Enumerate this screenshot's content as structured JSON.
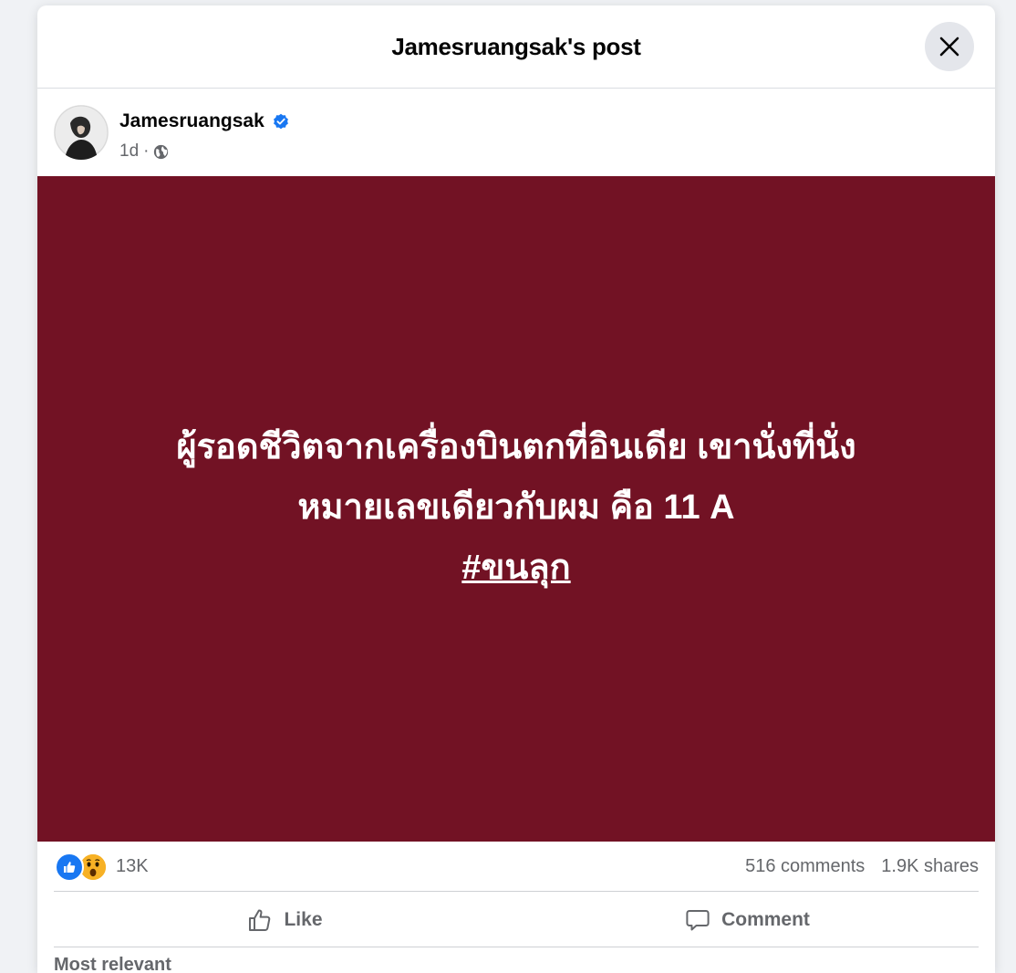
{
  "modal": {
    "title": "Jamesruangsak's post"
  },
  "post": {
    "author": "Jamesruangsak",
    "time": "1d",
    "separator": "·",
    "text_lines": [
      "ผู้รอดชีวิตจากเครื่องบินตกที่อินเดีย เขานั่งที่นั่ง",
      "หมายเลขเดียวกับผม คือ 11 A"
    ],
    "hashtag": "#ขนลุก",
    "background_color": "#721224"
  },
  "stats": {
    "reactions_count": "13K",
    "comments": "516 comments",
    "shares": "1.9K shares"
  },
  "actions": {
    "like_label": "Like",
    "comment_label": "Comment"
  },
  "comments_section": {
    "sort_label": "Most relevant"
  },
  "icons": {
    "close": "close-icon",
    "verified": "verified-badge-icon",
    "privacy": "globe-icon",
    "like_reaction": "like-reaction-icon",
    "wow_reaction": "wow-reaction-icon",
    "like": "thumbs-up-icon",
    "comment": "comment-bubble-icon"
  },
  "colors": {
    "accent": "#1877f2",
    "secondary_text": "#65676b"
  }
}
